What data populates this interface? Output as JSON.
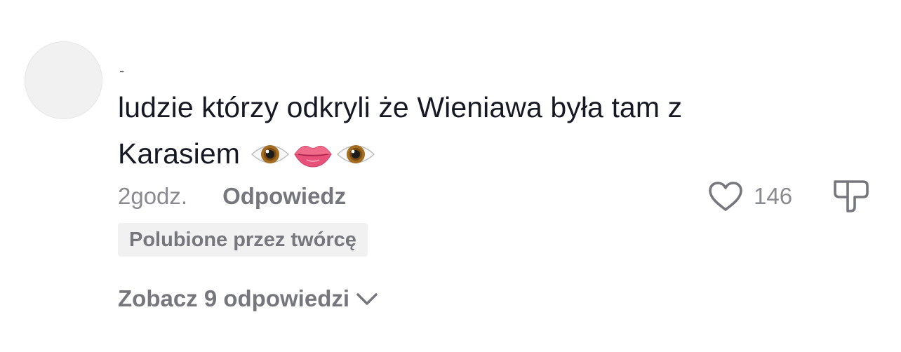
{
  "comment": {
    "username": "-",
    "text_line1": "ludzie którzy odkryli że Wieniawa była tam z",
    "text_line2": "Karasiem",
    "emojis": [
      "eye-emoji",
      "lips-emoji",
      "eye-emoji"
    ],
    "time": "2godz.",
    "reply_label": "Odpowiedz",
    "like_count": "146",
    "creator_badge": "Polubione przez twórcę",
    "view_replies": "Zobacz 9 odpowiedzi"
  },
  "icons": {
    "heart": "heart-outline-icon",
    "dislike": "thumbs-down-icon",
    "chevron": "chevron-down-icon"
  },
  "colors": {
    "text_primary": "#161823",
    "text_secondary": "#8a8b91",
    "text_bold_secondary": "#76777d",
    "badge_background": "#f1f1f2"
  }
}
